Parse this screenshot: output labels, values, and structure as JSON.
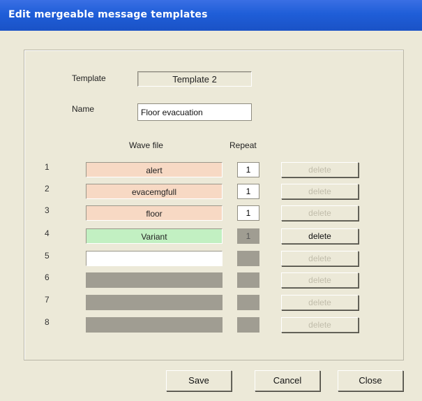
{
  "window": {
    "title": "Edit mergeable message templates"
  },
  "form": {
    "template_label": "Template",
    "template_value": "Template 2",
    "name_label": "Name",
    "name_value": "Floor evacuation"
  },
  "table": {
    "headers": {
      "wave": "Wave file",
      "repeat": "Repeat"
    },
    "rows": [
      {
        "num": "1",
        "wave": "alert",
        "repeat": "1",
        "delete": "delete"
      },
      {
        "num": "2",
        "wave": "evacemgfull",
        "repeat": "1",
        "delete": "delete"
      },
      {
        "num": "3",
        "wave": "floor",
        "repeat": "1",
        "delete": "delete"
      },
      {
        "num": "4",
        "wave": "Variant",
        "repeat": "1",
        "delete": "delete"
      },
      {
        "num": "5",
        "wave": "",
        "repeat": "",
        "delete": "delete"
      },
      {
        "num": "6",
        "wave": "",
        "repeat": "",
        "delete": "delete"
      },
      {
        "num": "7",
        "wave": "",
        "repeat": "",
        "delete": "delete"
      },
      {
        "num": "8",
        "wave": "",
        "repeat": "",
        "delete": "delete"
      }
    ]
  },
  "buttons": {
    "save": "Save",
    "cancel": "Cancel",
    "close": "Close"
  },
  "colors": {
    "titlebar": "#1f5ed8",
    "wave_existing": "#f7d9c4",
    "wave_variant": "#c2f0c2",
    "disabled_slot": "#a09d92"
  }
}
